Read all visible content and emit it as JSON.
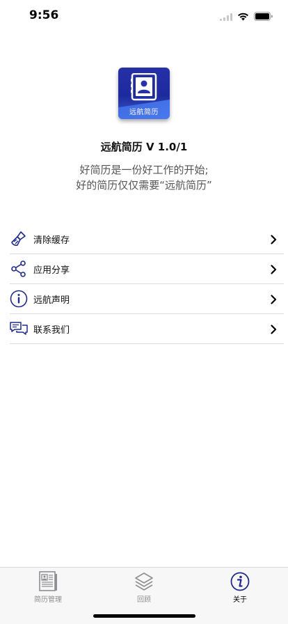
{
  "status_bar": {
    "time": "9:56"
  },
  "app": {
    "logo_text": "远航简历",
    "title": "远航简历 V 1.0/1",
    "slogan_line1": "好简历是一份好工作的开始;",
    "slogan_line2": "好的简历仅仅需要“远航简历”"
  },
  "menu": {
    "items": [
      {
        "label": "清除缓存",
        "icon": "broom-icon"
      },
      {
        "label": "应用分享",
        "icon": "share-icon"
      },
      {
        "label": "远航声明",
        "icon": "info-circle-icon"
      },
      {
        "label": "联系我们",
        "icon": "chat-icon"
      }
    ]
  },
  "tab_bar": {
    "tabs": [
      {
        "label": "简历管理",
        "icon": "resume-icon",
        "active": false
      },
      {
        "label": "回顾",
        "icon": "layers-icon",
        "active": false
      },
      {
        "label": "关于",
        "icon": "info-icon",
        "active": true
      }
    ]
  },
  "colors": {
    "accent": "#1d2a8a",
    "inactive_tab": "#8e8e93",
    "separator": "#dcdcdc"
  }
}
